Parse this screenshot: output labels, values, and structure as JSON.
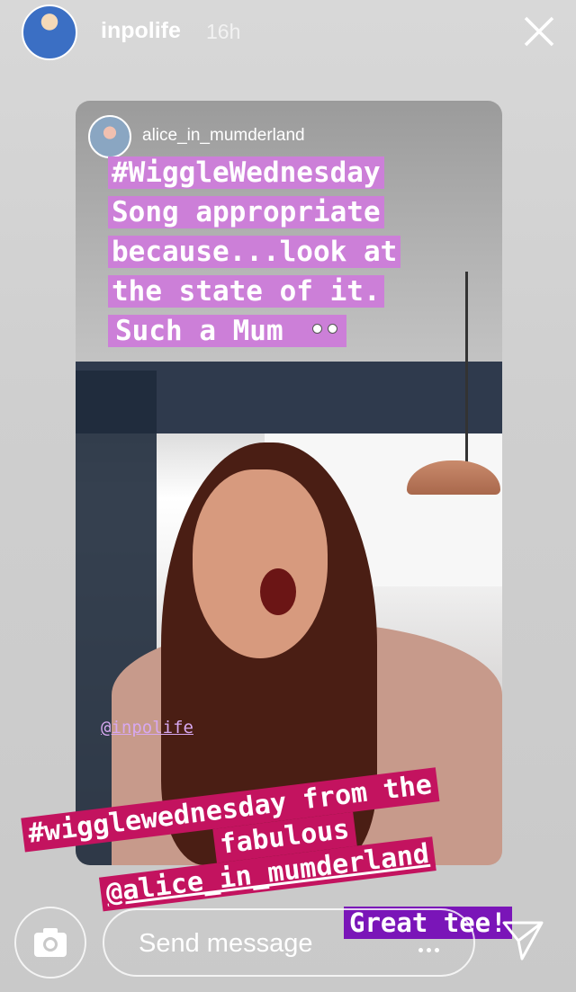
{
  "header": {
    "username": "inpolife",
    "time": "16h",
    "close_icon": "close-icon",
    "avatar": "avatar"
  },
  "story": {
    "shared_from_username": "alice_in_mumderland",
    "caption_lines": [
      "#WiggleWednesday",
      "Song appropriate",
      "because...look at",
      "the state of it.",
      "Such a Mum"
    ],
    "caption_emoji": "eye-roll-emoji",
    "watermark_mention": "@inpolife",
    "overlay_lines": [
      "#wigglewednesday from the",
      "fabulous",
      "@alice_in_mumderland"
    ],
    "sticker_text": "Great tee!"
  },
  "bottom_bar": {
    "camera_icon": "camera-icon",
    "message_placeholder": "Send message",
    "more_icon": "more-dots-icon",
    "send_icon": "send-icon"
  },
  "colors": {
    "caption_highlight": "#cc7fd8",
    "overlay_highlight": "#c3135f",
    "sticker_highlight": "#7a15b8"
  }
}
